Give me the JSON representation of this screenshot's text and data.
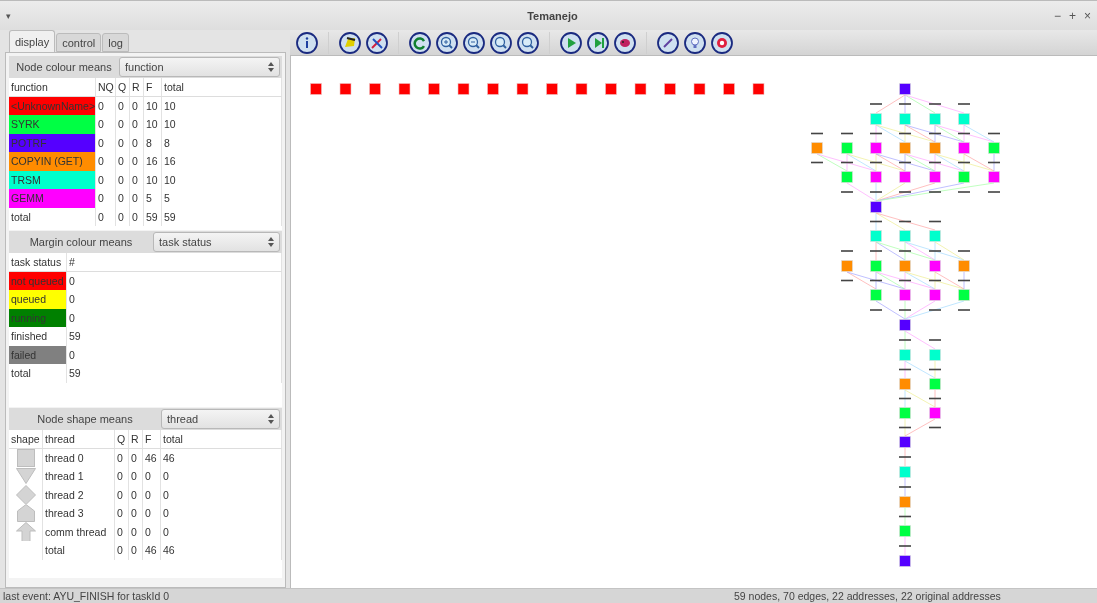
{
  "window": {
    "title": "Temanejo",
    "menu_glyph": "▾",
    "controls": [
      "−",
      "+",
      "×"
    ]
  },
  "tabs": [
    {
      "label": "display",
      "selected": true
    },
    {
      "label": "control",
      "selected": false
    },
    {
      "label": "log",
      "selected": false
    }
  ],
  "node_colour": {
    "label": "Node colour means",
    "value": "function",
    "columns": [
      "function",
      "NQ",
      "Q",
      "R",
      "F",
      "total"
    ],
    "rows": [
      {
        "color": "#ff0000",
        "cells": [
          "<UnknownName>",
          "0",
          "0",
          "0",
          "10",
          "10"
        ]
      },
      {
        "color": "#00ff44",
        "cells": [
          "SYRK",
          "0",
          "0",
          "0",
          "10",
          "10"
        ]
      },
      {
        "color": "#5500ff",
        "cells": [
          "POTRF",
          "0",
          "0",
          "0",
          "8",
          "8"
        ]
      },
      {
        "color": "#ff8c00",
        "cells": [
          "COPYIN (GET)",
          "0",
          "0",
          "0",
          "16",
          "16"
        ]
      },
      {
        "color": "#00ffcc",
        "cells": [
          "TRSM",
          "0",
          "0",
          "0",
          "10",
          "10"
        ]
      },
      {
        "color": "#ff00ff",
        "cells": [
          "GEMM",
          "0",
          "0",
          "0",
          "5",
          "5"
        ]
      },
      {
        "cells": [
          "total",
          "0",
          "0",
          "0",
          "59",
          "59"
        ]
      }
    ]
  },
  "margin_colour": {
    "label": "Margin colour means",
    "value": "task status",
    "columns": [
      "task status",
      "#"
    ],
    "rows": [
      {
        "color": "#ff0000",
        "cells": [
          "not queued",
          "0"
        ]
      },
      {
        "color": "#ffff00",
        "cells": [
          "queued",
          "0"
        ]
      },
      {
        "color": "#008000",
        "cells": [
          "running",
          "0"
        ]
      },
      {
        "cells": [
          "finished",
          "59"
        ]
      },
      {
        "color": "#808080",
        "cells": [
          "failed",
          "0"
        ]
      },
      {
        "cells": [
          "total",
          "59"
        ]
      }
    ]
  },
  "node_shape": {
    "label": "Node shape means",
    "value": "thread",
    "columns": [
      "shape",
      "thread",
      "Q",
      "R",
      "F",
      "total"
    ],
    "rows": [
      {
        "kind": "square",
        "cells": [
          "",
          "thread 0",
          "0",
          "0",
          "46",
          "46"
        ]
      },
      {
        "kind": "triangle",
        "cells": [
          "",
          "thread 1",
          "0",
          "0",
          "0",
          "0"
        ]
      },
      {
        "kind": "diamond",
        "cells": [
          "",
          "thread 2",
          "0",
          "0",
          "0",
          "0"
        ]
      },
      {
        "kind": "pentagon",
        "cells": [
          "",
          "thread 3",
          "0",
          "0",
          "0",
          "0"
        ]
      },
      {
        "kind": "arrow",
        "cells": [
          "",
          "comm thread",
          "0",
          "0",
          "0",
          "0"
        ]
      },
      {
        "kind": "none",
        "cells": [
          "",
          "total",
          "0",
          "0",
          "46",
          "46"
        ]
      }
    ]
  },
  "toolbar": [
    [
      {
        "kind": "info"
      }
    ],
    [
      {
        "kind": "hand"
      },
      {
        "kind": "tools"
      }
    ],
    [
      {
        "kind": "refresh"
      },
      {
        "kind": "zoom-in"
      },
      {
        "kind": "zoom-out"
      },
      {
        "kind": "zoom-fit"
      },
      {
        "kind": "zoom-reset"
      }
    ],
    [
      {
        "kind": "play"
      },
      {
        "kind": "step"
      },
      {
        "kind": "bug"
      }
    ],
    [
      {
        "kind": "wand"
      },
      {
        "kind": "bulb"
      },
      {
        "kind": "record"
      }
    ]
  ],
  "status_bar": {
    "left": "last event: AYU_FINISH for taskId 0",
    "right": "59 nodes, 70 edges, 22 addresses, 22 original addresses"
  }
}
